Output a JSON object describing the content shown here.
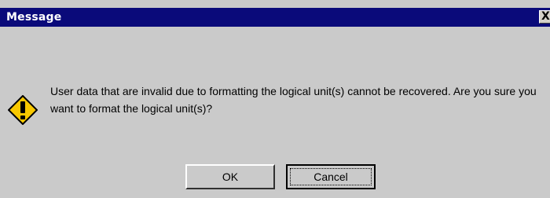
{
  "window": {
    "title": "Message",
    "close_label": "X"
  },
  "dialog": {
    "icon": "warning-icon",
    "message": "User data that are invalid due to formatting the logical unit(s) cannot be recovered. Are you sure you want to format the logical unit(s)?"
  },
  "buttons": {
    "ok_label": "OK",
    "cancel_label": "Cancel"
  },
  "colors": {
    "title_bar": "#0a0a7a",
    "background": "#cacaca",
    "icon_fill": "#f8c800"
  }
}
